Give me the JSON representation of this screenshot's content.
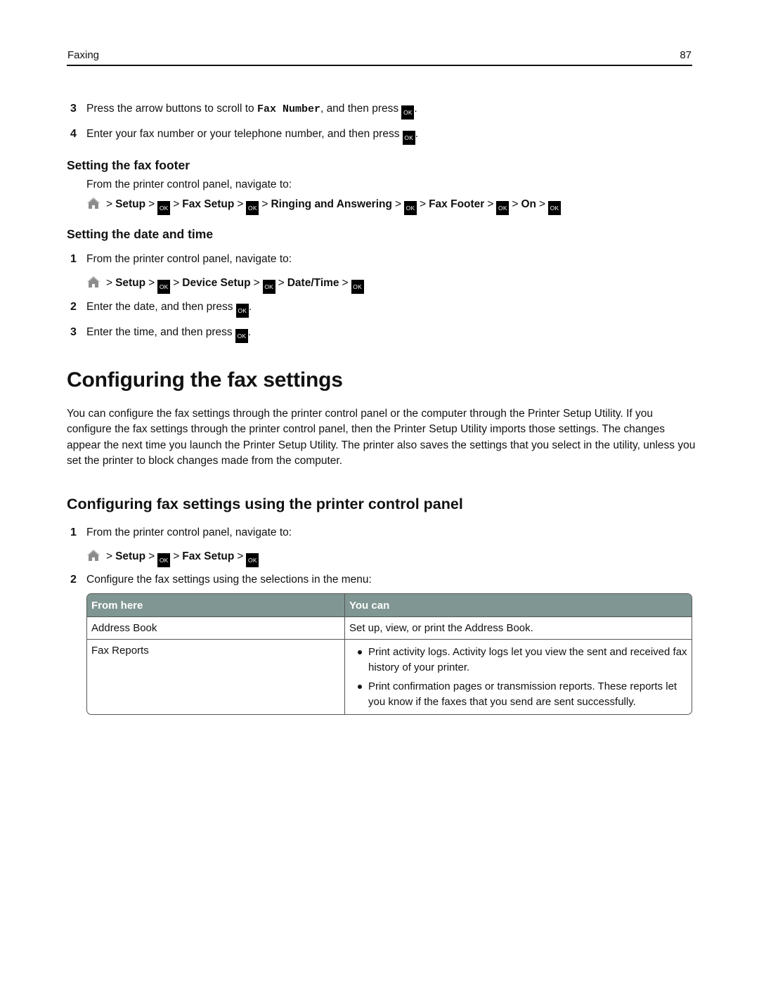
{
  "header": {
    "section": "Faxing",
    "page_number": "87"
  },
  "intro_steps": [
    {
      "num": "3",
      "before": "Press the arrow buttons to scroll to ",
      "code": "Fax Number",
      "after": ", and then press ",
      "end": "."
    },
    {
      "num": "4",
      "text": "Enter your fax number or your telephone number, and then press ",
      "end": "."
    }
  ],
  "ok_label": "OK",
  "home_icon": "home-icon",
  "fax_footer": {
    "heading": "Setting the fax footer",
    "instruction": "From the printer control panel, navigate to:",
    "path": [
      "Setup",
      "Fax Setup",
      "Ringing and Answering",
      "Fax Footer",
      "On"
    ]
  },
  "date_time": {
    "heading": "Setting the date and time",
    "steps": [
      {
        "num": "1",
        "text": "From the printer control panel, navigate to:"
      },
      {
        "num": "2",
        "text": "Enter the date, and then press ",
        "end": "."
      },
      {
        "num": "3",
        "text": "Enter the time, and then press ",
        "end": "."
      }
    ],
    "path": [
      "Setup",
      "Device Setup",
      "Date/Time"
    ]
  },
  "configuring": {
    "heading": "Configuring the fax settings",
    "paragraph": "You can configure the fax settings through the printer control panel or the computer through the Printer Setup Utility. If you configure the fax settings through the printer control panel, then the Printer Setup Utility imports those settings. The changes appear the next time you launch the Printer Setup Utility. The printer also saves the settings that you select in the utility, unless you set the printer to block changes made from the computer."
  },
  "control_panel": {
    "heading": "Configuring fax settings using the printer control panel",
    "steps": [
      {
        "num": "1",
        "text": "From the printer control panel, navigate to:"
      },
      {
        "num": "2",
        "text": "Configure the fax settings using the selections in the menu:"
      }
    ],
    "path": [
      "Setup",
      "Fax Setup"
    ]
  },
  "table": {
    "header_color": "#7f9692",
    "columns": [
      "From here",
      "You can"
    ],
    "rows": [
      {
        "from": "Address Book",
        "you_can": "Set up, view, or print the Address Book."
      },
      {
        "from": "Fax Reports",
        "bullets": [
          "Print activity logs. Activity logs let you view the sent and received fax history of your printer.",
          "Print confirmation pages or transmission reports. These reports let you know if the faxes that you send are sent successfully."
        ]
      }
    ]
  }
}
